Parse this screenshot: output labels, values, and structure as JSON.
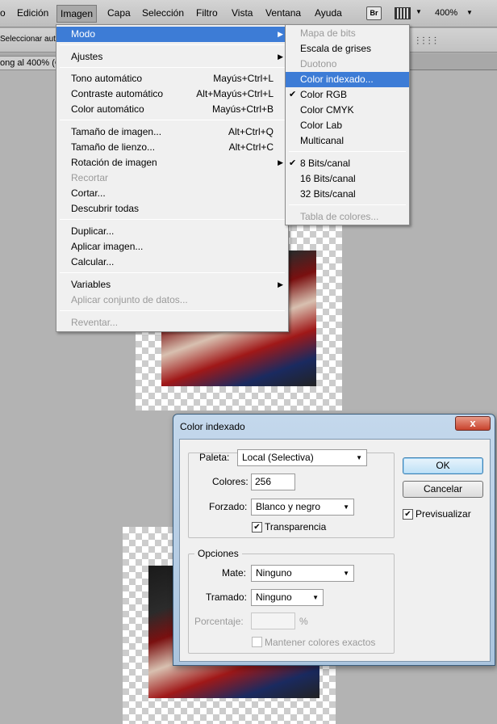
{
  "menubar": {
    "items": [
      {
        "label": "o"
      },
      {
        "label": "Edición"
      },
      {
        "label": "Imagen"
      },
      {
        "label": "Capa"
      },
      {
        "label": "Selección"
      },
      {
        "label": "Filtro"
      },
      {
        "label": "Vista"
      },
      {
        "label": "Ventana"
      },
      {
        "label": "Ayuda"
      }
    ],
    "bridge_label": "Br",
    "zoom": "400%"
  },
  "options_bar": {
    "auto_select_label": "Seleccionar auto"
  },
  "document_tab": {
    "title": "ong al 400% (C"
  },
  "imagen_menu": {
    "items": [
      {
        "label": "Modo"
      },
      {
        "label": "Ajustes"
      },
      {
        "label": "Tono automático",
        "shortcut": "Mayús+Ctrl+L"
      },
      {
        "label": "Contraste automático",
        "shortcut": "Alt+Mayús+Ctrl+L"
      },
      {
        "label": "Color automático",
        "shortcut": "Mayús+Ctrl+B"
      },
      {
        "label": "Tamaño de imagen...",
        "shortcut": "Alt+Ctrl+Q"
      },
      {
        "label": "Tamaño de lienzo...",
        "shortcut": "Alt+Ctrl+C"
      },
      {
        "label": "Rotación de imagen"
      },
      {
        "label": "Recortar"
      },
      {
        "label": "Cortar..."
      },
      {
        "label": "Descubrir todas"
      },
      {
        "label": "Duplicar..."
      },
      {
        "label": "Aplicar imagen..."
      },
      {
        "label": "Calcular..."
      },
      {
        "label": "Variables"
      },
      {
        "label": "Aplicar conjunto de datos..."
      },
      {
        "label": "Reventar..."
      }
    ]
  },
  "modo_submenu": {
    "items": [
      {
        "label": "Mapa de bits"
      },
      {
        "label": "Escala de grises"
      },
      {
        "label": "Duotono"
      },
      {
        "label": "Color indexado..."
      },
      {
        "label": "Color RGB"
      },
      {
        "label": "Color CMYK"
      },
      {
        "label": "Color Lab"
      },
      {
        "label": "Multicanal"
      },
      {
        "label": "8 Bits/canal"
      },
      {
        "label": "16 Bits/canal"
      },
      {
        "label": "32 Bits/canal"
      },
      {
        "label": "Tabla de colores..."
      }
    ],
    "check_mark": "✔"
  },
  "dialog": {
    "title": "Color indexado",
    "close_glyph": "x",
    "paleta_label": "Paleta:",
    "paleta_value": "Local (Selectiva)",
    "colores_label": "Colores:",
    "colores_value": "256",
    "forzado_label": "Forzado:",
    "forzado_value": "Blanco y negro",
    "transparencia_label": "Transparencia",
    "transparencia_checked": "✔",
    "opciones_label": "Opciones",
    "mate_label": "Mate:",
    "mate_value": "Ninguno",
    "tramado_label": "Tramado:",
    "tramado_value": "Ninguno",
    "porcentaje_label": "Porcentaje:",
    "porcentaje_unit": "%",
    "mantener_label": "Mantener colores exactos",
    "ok_label": "OK",
    "cancelar_label": "Cancelar",
    "previsualizar_label": "Previsualizar",
    "previsualizar_checked": "✔"
  }
}
